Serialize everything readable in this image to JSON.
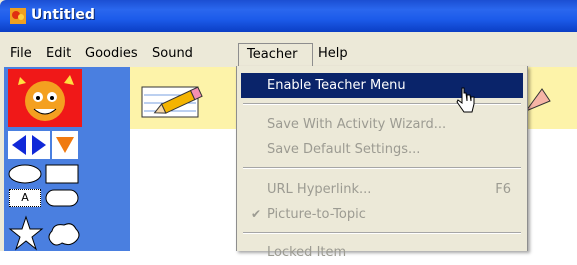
{
  "window": {
    "title": "Untitled"
  },
  "menubar": {
    "items": [
      {
        "label": "File"
      },
      {
        "label": "Edit"
      },
      {
        "label": "Goodies"
      },
      {
        "label": "Sound"
      },
      {
        "label": "Teacher"
      },
      {
        "label": "Help"
      }
    ]
  },
  "teacher_menu": {
    "items": [
      {
        "label": "Enable Teacher Menu",
        "state": "highlighted"
      },
      {
        "label": "Save With Activity Wizard...",
        "state": "disabled"
      },
      {
        "label": "Save Default Settings...",
        "state": "disabled"
      },
      {
        "label": "URL Hyperlink...",
        "shortcut": "F6",
        "state": "disabled"
      },
      {
        "label": "Picture-to-Topic",
        "state": "disabled",
        "checked": true
      },
      {
        "label": "Locked Item",
        "state": "disabled"
      }
    ]
  },
  "tools": {
    "text_tool_label": "A"
  },
  "colors": {
    "titlebar": "#2a67ee",
    "menu_highlight": "#0a246a",
    "toolbar_bg": "#4a7fe0",
    "yellow_bar": "#fdf3a9"
  },
  "icons": [
    "app-icon",
    "mascot-icon",
    "pencil-icon",
    "arrow-left-icon",
    "arrow-right-icon",
    "arrow-down-icon",
    "oval-tool-icon",
    "rectangle-tool-icon",
    "text-tool-icon",
    "rounded-rect-tool-icon",
    "star-tool-icon",
    "cloud-tool-icon",
    "cursor-icon",
    "checkmark-icon"
  ]
}
